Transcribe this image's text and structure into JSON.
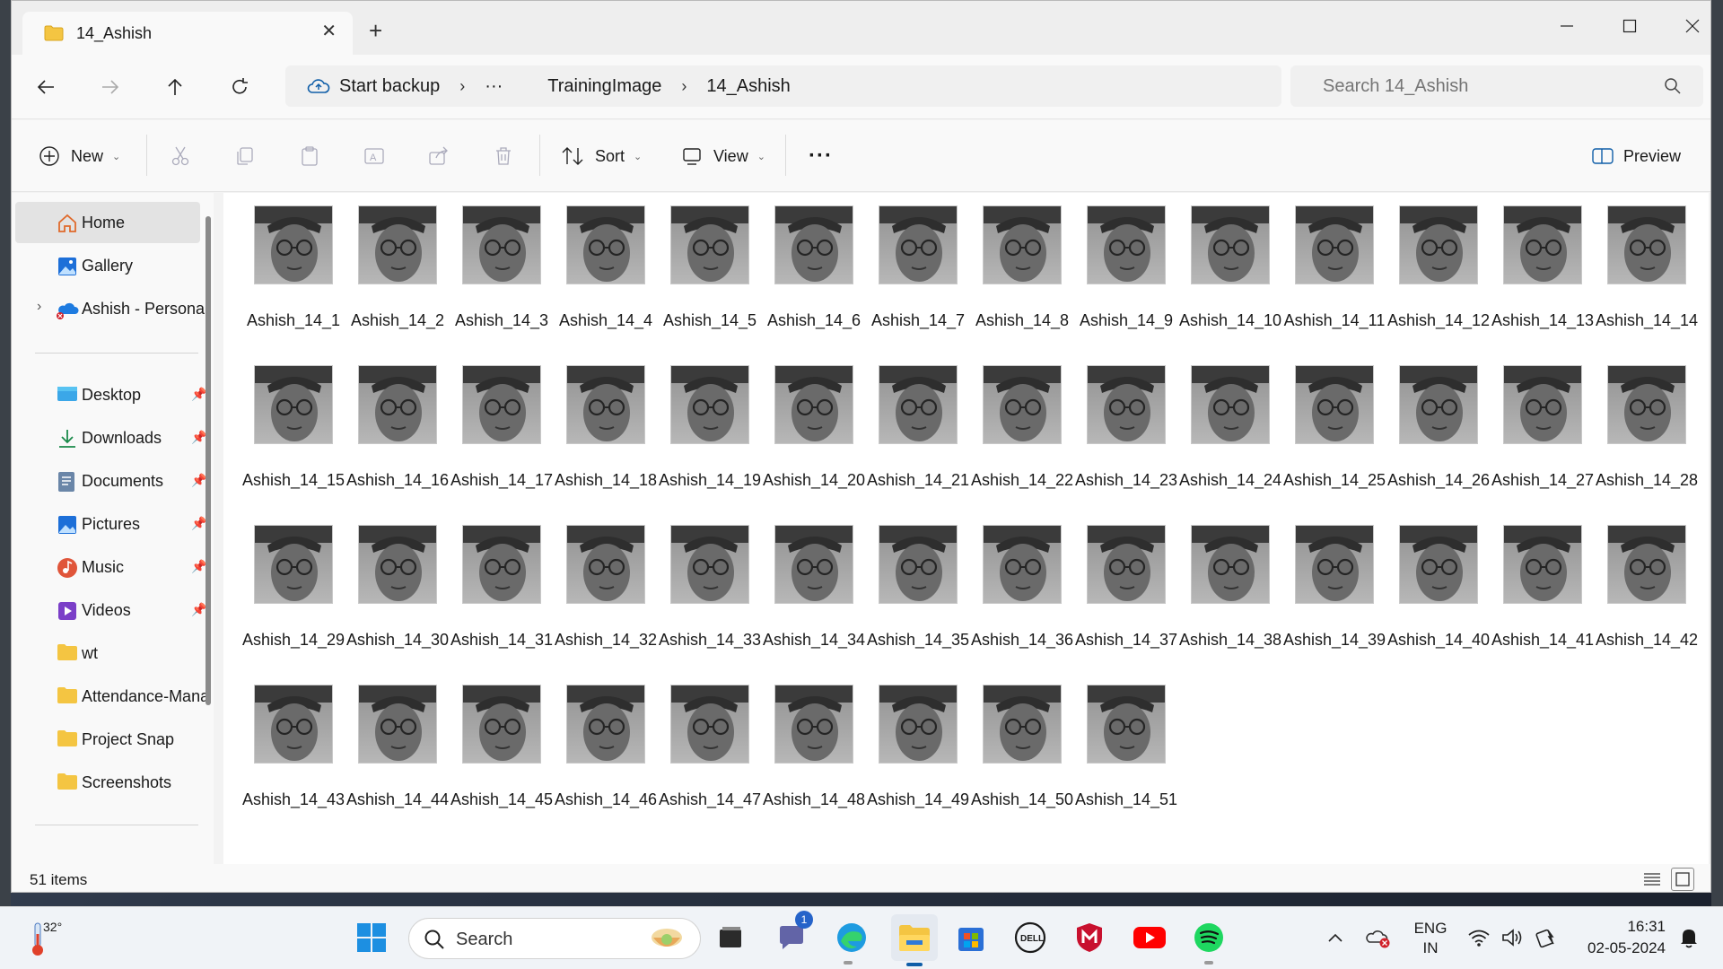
{
  "window": {
    "tab_title": "14_Ashish",
    "tab_close": "✕",
    "new_tab": "+"
  },
  "address": {
    "crumbs": [
      "Start backup",
      "···",
      "TrainingImage",
      "14_Ashish"
    ],
    "search_placeholder": "Search 14_Ashish"
  },
  "commands": {
    "new_label": "New",
    "sort_label": "Sort",
    "view_label": "View",
    "more_label": "···",
    "preview_label": "Preview"
  },
  "sidebar": {
    "top_items": [
      {
        "label": "Home",
        "icon": "home-icon"
      },
      {
        "label": "Gallery",
        "icon": "gallery-icon"
      },
      {
        "label": "Ashish - Personal",
        "icon": "onedrive-icon"
      }
    ],
    "quick_access": [
      {
        "label": "Desktop",
        "icon": "desktop-icon",
        "pinned": true
      },
      {
        "label": "Downloads",
        "icon": "downloads-icon",
        "pinned": true
      },
      {
        "label": "Documents",
        "icon": "documents-icon",
        "pinned": true
      },
      {
        "label": "Pictures",
        "icon": "pictures-icon",
        "pinned": true
      },
      {
        "label": "Music",
        "icon": "music-icon",
        "pinned": true
      },
      {
        "label": "Videos",
        "icon": "videos-icon",
        "pinned": true
      },
      {
        "label": "wt",
        "icon": "folder-icon",
        "pinned": false
      },
      {
        "label": "Attendance-Management",
        "icon": "folder-icon",
        "pinned": false
      },
      {
        "label": "Project Snap",
        "icon": "folder-icon",
        "pinned": false
      },
      {
        "label": "Screenshots",
        "icon": "folder-icon",
        "pinned": false
      }
    ]
  },
  "files": {
    "prefix": "Ashish_14_",
    "numbers": [
      1,
      2,
      3,
      4,
      5,
      6,
      7,
      8,
      9,
      10,
      11,
      12,
      13,
      14,
      15,
      16,
      17,
      18,
      19,
      20,
      21,
      22,
      23,
      24,
      25,
      26,
      27,
      28,
      29,
      30,
      31,
      32,
      33,
      34,
      35,
      36,
      37,
      38,
      39,
      40,
      41,
      42,
      43,
      44,
      45,
      46,
      47,
      48,
      49,
      50,
      51
    ]
  },
  "status": {
    "item_count": "51 items"
  },
  "taskbar": {
    "weather_temp": "32°",
    "search_label": "Search",
    "chat_badge": "1",
    "lang_top": "ENG",
    "lang_bottom": "IN",
    "time": "16:31",
    "date": "02-05-2024"
  },
  "colors": {
    "accent": "#0067c0",
    "folder": "#f4c542"
  }
}
